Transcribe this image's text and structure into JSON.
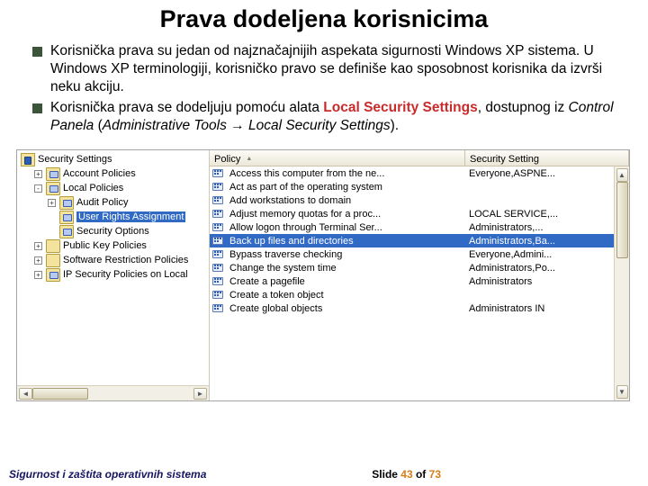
{
  "title": "Prava dodeljena korisnicima",
  "bullets": [
    {
      "plain1": "Korisnička prava su jedan od najznačajnijih aspekata sigurnosti Windows XP sistema. U Windows XP terminologiji, korisničko pravo se definiše kao sposobnost korisnika da izvrši neku akciju."
    },
    {
      "plain_before": "Korisnička prava se dodeljuju pomoću alata ",
      "bold_red": "Local Security Settings",
      "plain_mid1": ", dostupnog iz ",
      "italic1": "Control Panela",
      "plain_mid2": " (",
      "italic2": "Administrative Tools → Local Security Settings",
      "plain_mid3": ")."
    }
  ],
  "tree": {
    "root": "Security Settings",
    "items": [
      {
        "label": "Account Policies",
        "depth": 2,
        "icon": "blue",
        "expander": "+"
      },
      {
        "label": "Local Policies",
        "depth": 2,
        "icon": "blue",
        "expander": "-"
      },
      {
        "label": "Audit Policy",
        "depth": 3,
        "icon": "blue",
        "expander": "+"
      },
      {
        "label": "User Rights Assignment",
        "depth": 3,
        "icon": "blue",
        "expander": "",
        "selected": true
      },
      {
        "label": "Security Options",
        "depth": 3,
        "icon": "blue",
        "expander": ""
      },
      {
        "label": "Public Key Policies",
        "depth": 2,
        "icon": "plain",
        "expander": "+"
      },
      {
        "label": "Software Restriction Policies",
        "depth": 2,
        "icon": "plain",
        "expander": "+"
      },
      {
        "label": "IP Security Policies on Local",
        "depth": 2,
        "icon": "blue",
        "expander": "+"
      }
    ]
  },
  "columns": {
    "policy": "Policy",
    "setting": "Security Setting"
  },
  "policies": [
    {
      "name": "Access this computer from the ne...",
      "setting": "Everyone,ASPNE..."
    },
    {
      "name": "Act as part of the operating system",
      "setting": ""
    },
    {
      "name": "Add workstations to domain",
      "setting": ""
    },
    {
      "name": "Adjust memory quotas for a proc...",
      "setting": "LOCAL SERVICE,..."
    },
    {
      "name": "Allow logon through Terminal Ser...",
      "setting": "Administrators,..."
    },
    {
      "name": "Back up files and directories",
      "setting": "Administrators,Ba...",
      "selected": true
    },
    {
      "name": "Bypass traverse checking",
      "setting": "Everyone,Admini..."
    },
    {
      "name": "Change the system time",
      "setting": "Administrators,Po..."
    },
    {
      "name": "Create a pagefile",
      "setting": "Administrators"
    },
    {
      "name": "Create a token object",
      "setting": ""
    },
    {
      "name": "Create global objects",
      "setting": "Administrators IN"
    }
  ],
  "footer": {
    "left": "Sigurnost i zaštita operativnih sistema",
    "right_prefix": "Slide ",
    "right_num": "43",
    "right_mid": " of ",
    "right_total": "73"
  }
}
